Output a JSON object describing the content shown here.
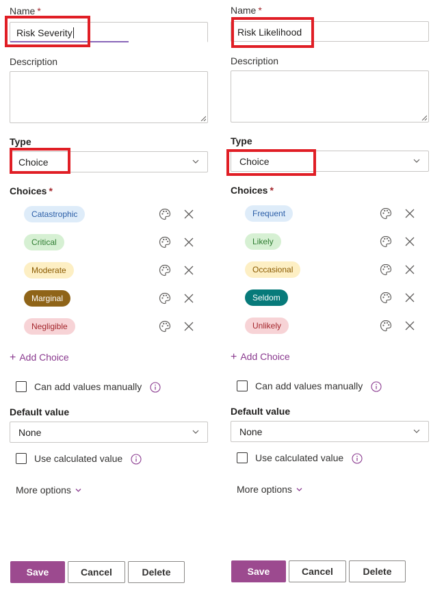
{
  "colors": {
    "accent": "#9c4a8f",
    "highlight_box": "#e01e25",
    "required": "#a4262c",
    "link": "#8a3a8f"
  },
  "icons": {
    "palette": "palette-icon",
    "remove": "close-icon",
    "dropdown": "chevron-down-icon",
    "add": "plus-icon",
    "info": "info-icon",
    "resize": "resize-grip-icon"
  },
  "left": {
    "name_label": "Name",
    "required_mark": "*",
    "name_value": "Risk Severity",
    "name_focus_progress": 0.6,
    "description_label": "Description",
    "description_value": "",
    "type_label": "Type",
    "type_value": "Choice",
    "choices_label": "Choices",
    "choices": [
      {
        "label": "Catastrophic",
        "bg": "#deecf9",
        "fg": "#2b5ea7"
      },
      {
        "label": "Critical",
        "bg": "#d6f0d3",
        "fg": "#2f7d32"
      },
      {
        "label": "Moderate",
        "bg": "#fdefc4",
        "fg": "#8a5a00"
      },
      {
        "label": "Marginal",
        "bg": "#8f6418",
        "fg": "#ffffff"
      },
      {
        "label": "Negligible",
        "bg": "#f7d3d6",
        "fg": "#a4262c"
      }
    ],
    "add_choice_label": "Add Choice",
    "manual_label": "Can add values manually",
    "default_label": "Default value",
    "default_value": "None",
    "calculated_label": "Use calculated value",
    "more_options_label": "More options",
    "save_label": "Save",
    "cancel_label": "Cancel",
    "delete_label": "Delete"
  },
  "right": {
    "name_label": "Name",
    "required_mark": "*",
    "name_value": "Risk Likelihood",
    "description_label": "Description",
    "description_value": "",
    "type_label": "Type",
    "type_value": "Choice",
    "choices_label": "Choices",
    "choices": [
      {
        "label": "Frequent",
        "bg": "#deecf9",
        "fg": "#2b5ea7"
      },
      {
        "label": "Likely",
        "bg": "#d6f0d3",
        "fg": "#2f7d32"
      },
      {
        "label": "Occasional",
        "bg": "#fdefc4",
        "fg": "#8a5a00"
      },
      {
        "label": "Seldom",
        "bg": "#077a7a",
        "fg": "#ffffff"
      },
      {
        "label": "Unlikely",
        "bg": "#f7d3d6",
        "fg": "#a4262c"
      }
    ],
    "add_choice_label": "Add Choice",
    "manual_label": "Can add values manually",
    "default_label": "Default value",
    "default_value": "None",
    "calculated_label": "Use calculated value",
    "more_options_label": "More options",
    "save_label": "Save",
    "cancel_label": "Cancel",
    "delete_label": "Delete"
  }
}
